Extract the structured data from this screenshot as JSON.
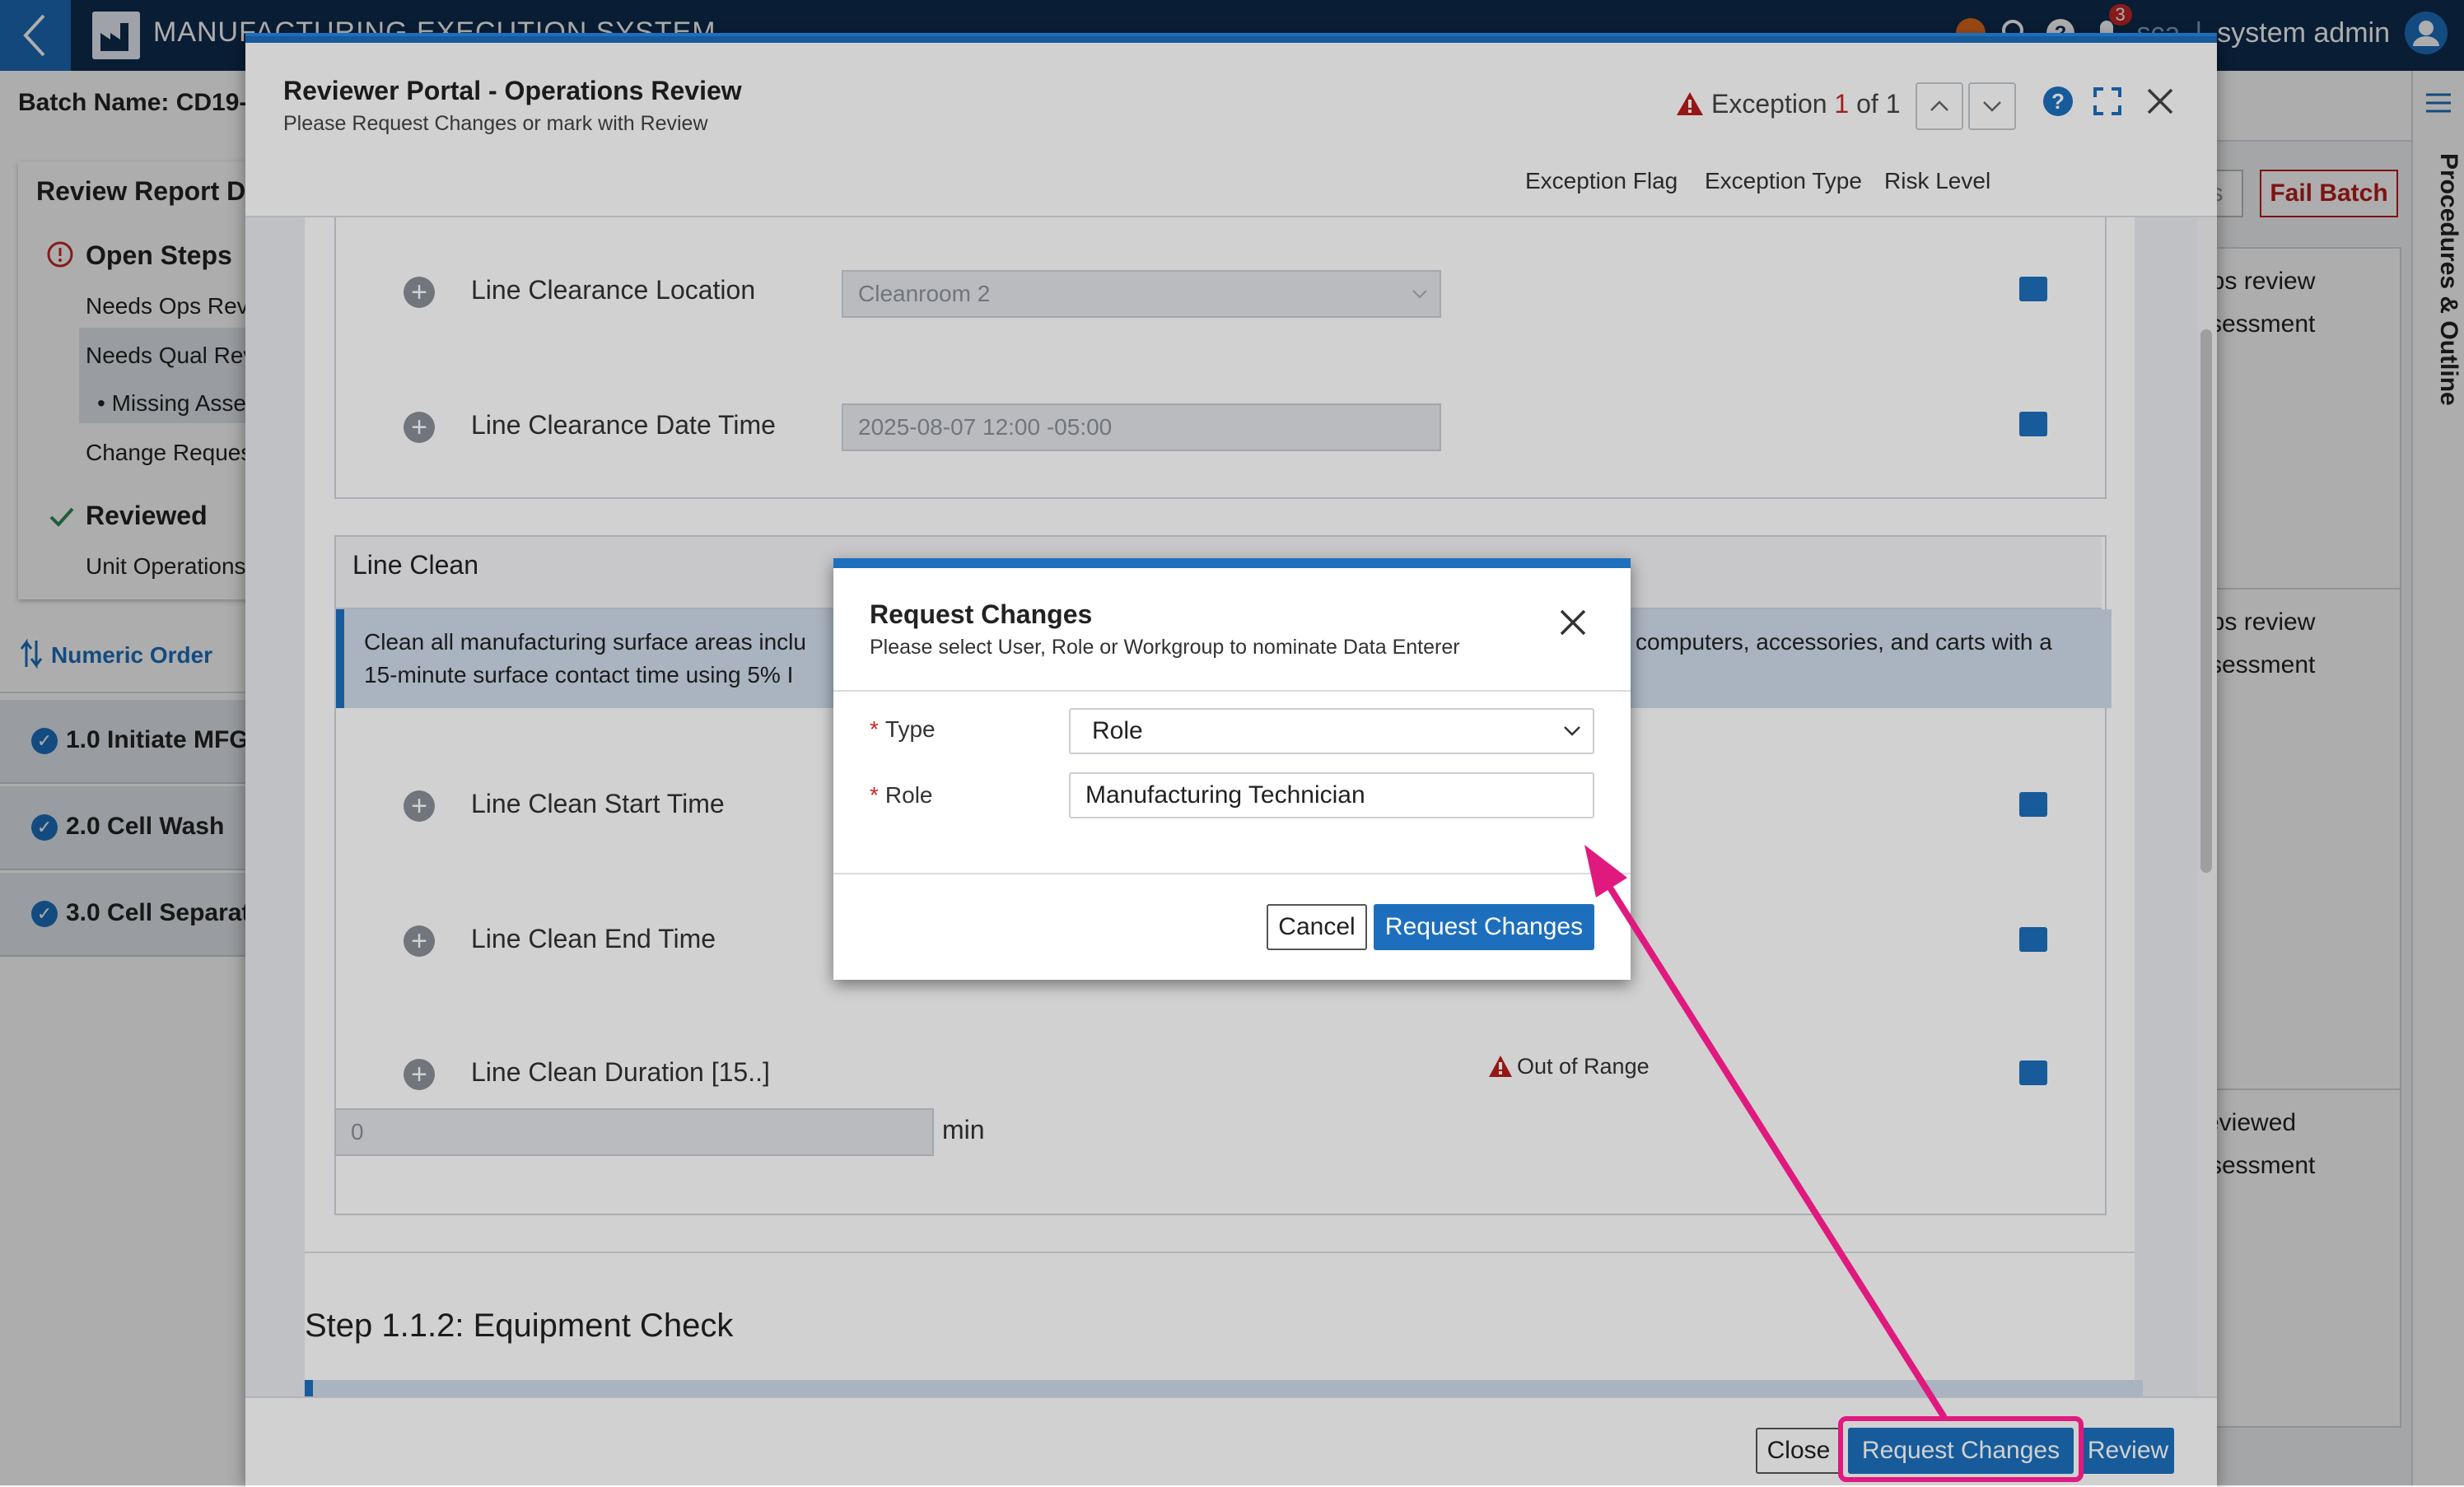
{
  "app": {
    "title": "MANUFACTURING EXECUTION SYSTEM",
    "notification_count": "3",
    "user_name": "system admin",
    "user_short": "sca"
  },
  "batch": {
    "name_label": "Batch Name: CD19-1"
  },
  "left_panel": {
    "report_title": "Review Report Da",
    "open_steps": "Open Steps",
    "needs_ops": "Needs Ops Revi",
    "needs_qual": "Needs Qual Rev",
    "missing": "Missing Asse",
    "change_request": "Change Request",
    "reviewed": "Reviewed",
    "unit_ops": "Unit Operations",
    "numeric_order": "Numeric Order",
    "items": [
      {
        "label": "1.0 Initiate MFG"
      },
      {
        "label": "2.0 Cell Wash"
      },
      {
        "label": "3.0 Cell Separat"
      }
    ]
  },
  "right_area": {
    "partial_btn": "s",
    "fail_batch": "Fail Batch",
    "card1_l1": "ops review",
    "card1_l2": "ssessment",
    "card2_l1": "ops review",
    "card2_l2": "ssessment",
    "card3_l1": "reviewed",
    "card3_l2": "ssessment",
    "rail_label": "Procedures & Outline"
  },
  "portal": {
    "title": "Reviewer Portal - Operations Review",
    "subtitle": "Please Request Changes or mark with Review",
    "exception_prefix": "Exception",
    "exception_current": "1",
    "exception_of": "of 1",
    "columns": {
      "flag": "Exception Flag",
      "type": "Exception Type",
      "risk": "Risk Level"
    },
    "fields": {
      "location_label": "Line Clearance Location",
      "location_value": "Cleanroom 2",
      "datetime_label": "Line Clearance Date Time",
      "datetime_value": "2025-08-07 12:00 -05:00",
      "section_title": "Line Clean",
      "banner_left_l1": "Clean all manufacturing surface areas inclu",
      "banner_left_l2": "15-minute surface contact time using 5% I",
      "banner_right": "computers, accessories, and carts with a",
      "start_label": "Line Clean Start Time",
      "end_label": "Line Clean End Time",
      "duration_label": "Line Clean Duration [15..]",
      "out_of_range": "Out of Range",
      "duration_value": "0",
      "duration_unit": "min"
    },
    "step_title": "Step 1.1.2: Equipment Check",
    "footer": {
      "close": "Close",
      "request_changes": "Request Changes",
      "review": "Review"
    }
  },
  "dialog": {
    "title": "Request Changes",
    "subtitle": "Please select User, Role or Workgroup to nominate Data Enterer",
    "required_mark": "*",
    "type_label": "Type",
    "type_value": "Role",
    "role_label": "Role",
    "role_value": "Manufacturing Technician",
    "cancel": "Cancel",
    "submit": "Request Changes"
  },
  "colors": {
    "primary": "#1d6fbe",
    "navy": "#0e2c4d",
    "annotation": "#e0197f",
    "danger": "#b71c1c"
  }
}
